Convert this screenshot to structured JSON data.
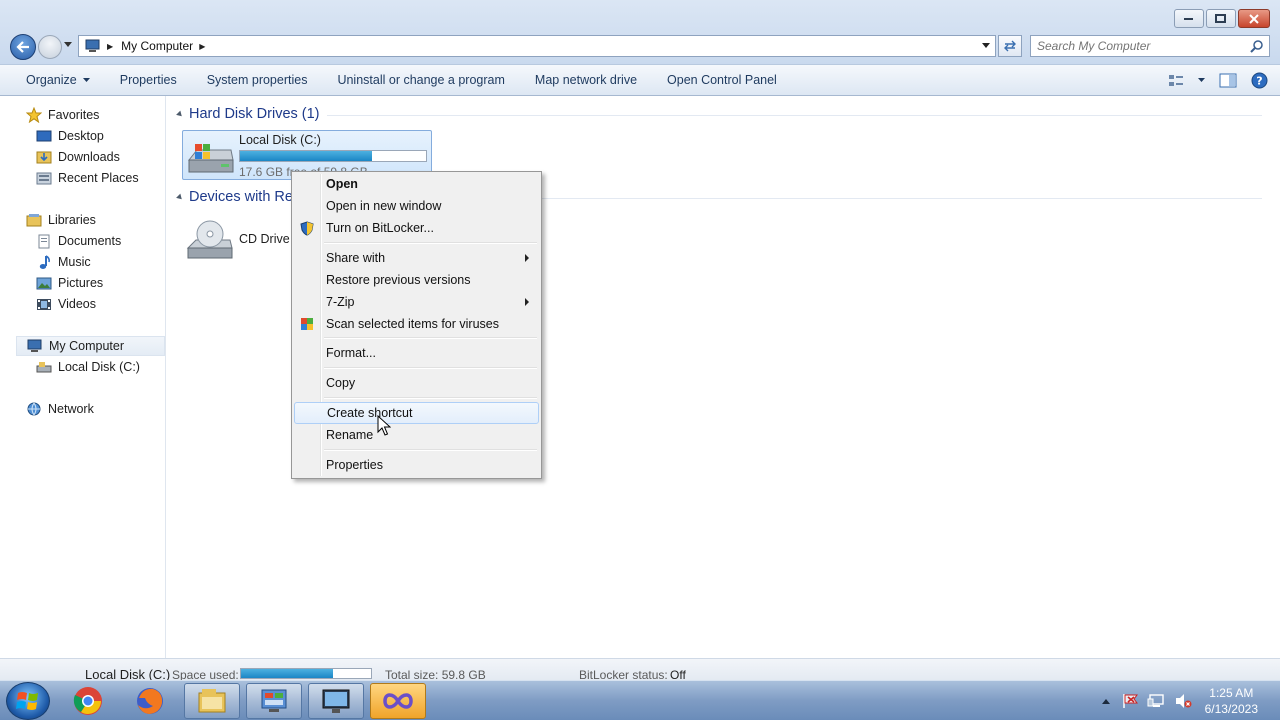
{
  "window": {
    "address_crumb": "My Computer",
    "search_placeholder": "Search My Computer"
  },
  "toolbar": {
    "items": [
      "Organize",
      "Properties",
      "System properties",
      "Uninstall or change a program",
      "Map network drive",
      "Open Control Panel"
    ]
  },
  "nav": {
    "favorites": "Favorites",
    "desktop": "Desktop",
    "downloads": "Downloads",
    "recent": "Recent Places",
    "libraries": "Libraries",
    "documents": "Documents",
    "music": "Music",
    "pictures": "Pictures",
    "videos": "Videos",
    "computer": "My Computer",
    "local_disk": "Local Disk (C:)",
    "network": "Network"
  },
  "content": {
    "hdd_group": "Hard Disk Drives (1)",
    "removable_group": "Devices with Re",
    "local_disk_name": "Local Disk (C:)",
    "local_disk_free": "17.6 GB free of 59.8 GB",
    "local_disk_used_fraction": 0.71,
    "cd_drive_name": "CD Drive ("
  },
  "context_menu": {
    "open": "Open",
    "open_new_window": "Open in new window",
    "bitlocker": "Turn on BitLocker...",
    "share_with": "Share with",
    "restore": "Restore previous versions",
    "zip": "7-Zip",
    "scan": "Scan selected items for viruses",
    "format": "Format...",
    "copy": "Copy",
    "create_shortcut": "Create shortcut",
    "rename": "Rename",
    "properties": "Properties"
  },
  "details": {
    "name": "Local Disk (C:)",
    "space_used_label": "Space used:",
    "space_used_fraction": 0.71,
    "total_size": "Total size: 59.8 GB",
    "bitlocker_label": "BitLocker status:",
    "bitlocker_value": "Off"
  },
  "clock": {
    "time": "1:25 AM",
    "date": "6/13/2023"
  },
  "colors": {
    "accent": "#1b86c5",
    "group_header": "#1e3a8a",
    "taskbar": "#7f9cc4"
  }
}
